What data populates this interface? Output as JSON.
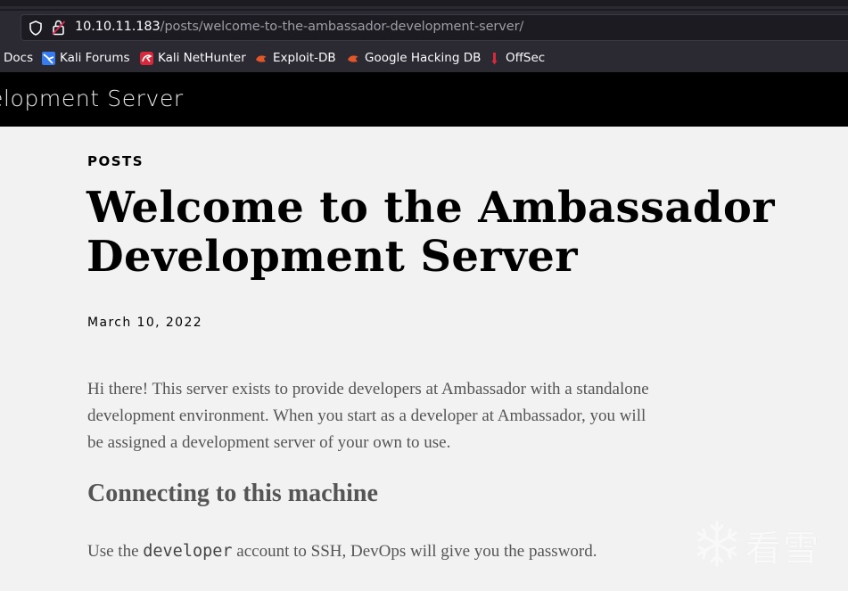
{
  "browser": {
    "url_host": "10.10.11.183",
    "url_path": "/posts/welcome-to-the-ambassador-development-server/",
    "bookmarks": [
      {
        "label": "Docs",
        "icon": "docs-icon"
      },
      {
        "label": "Kali Forums",
        "icon": "kali-forums-icon"
      },
      {
        "label": "Kali NetHunter",
        "icon": "kali-nethunter-icon"
      },
      {
        "label": "Exploit-DB",
        "icon": "exploit-db-icon"
      },
      {
        "label": "Google Hacking DB",
        "icon": "google-hacking-db-icon"
      },
      {
        "label": "OffSec",
        "icon": "offsec-icon"
      }
    ]
  },
  "site": {
    "title": "elopment Server"
  },
  "post": {
    "category": "POSTS",
    "title": "Welcome to the Ambassador Development Server",
    "date": "March 10, 2022",
    "intro": "Hi there! This server exists to provide developers at Ambassador with a standalone development environment. When you start as a developer at Ambassador, you will be assigned a development server of your own to use.",
    "section_heading": "Connecting to this machine",
    "ssh_before": "Use the ",
    "ssh_code": "developer",
    "ssh_after": " account to SSH, DevOps will give you the password."
  },
  "watermark": {
    "text": "看雪",
    "icon": "snowflake-icon"
  },
  "colors": {
    "page_bg": "#f2f2f2",
    "header_bg": "#000000",
    "body_text": "#555555",
    "chrome_bg": "#2b2a33"
  }
}
